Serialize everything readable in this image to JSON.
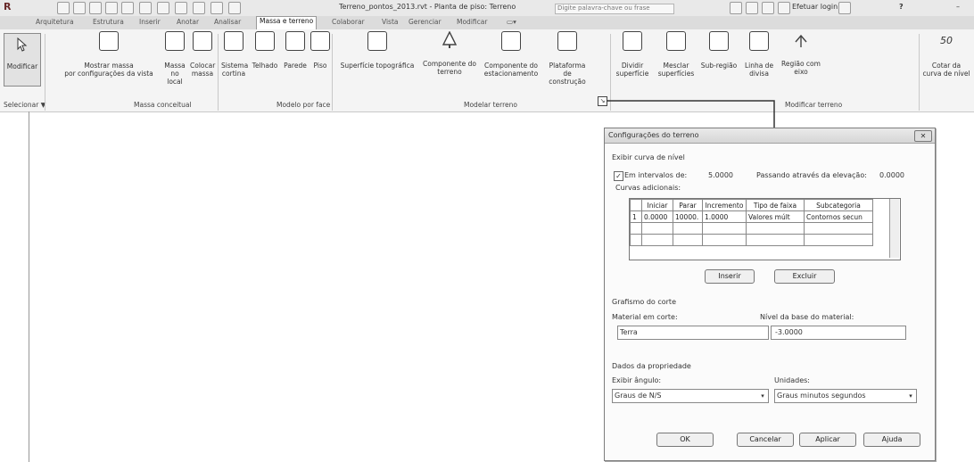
{
  "title_bar": {
    "app_menu": "R",
    "file_title": "Terreno_pontos_2013.rvt - Planta de piso: Terreno",
    "search_placeholder": "Digite palavra-chave ou frase",
    "signin_label": "Efetuar login",
    "help_label": "?"
  },
  "tabs": [
    "Arquitetura",
    "Estrutura",
    "Inserir",
    "Anotar",
    "Analisar",
    "Massa e terreno",
    "Colaborar",
    "Vista",
    "Gerenciar",
    "Modificar"
  ],
  "active_tab": "Massa e terreno",
  "ribbon": {
    "tools": {
      "modificar": "Modificar",
      "mostrar_massa": [
        "Mostrar massa",
        "por configurações da vista"
      ],
      "massa": [
        "Massa",
        "no local"
      ],
      "colocar_massa": [
        "Colocar",
        "massa"
      ],
      "sistema_cortina": [
        "Sistema",
        "cortina"
      ],
      "telhado": "Telhado",
      "parede": "Parede",
      "piso": "Piso",
      "superficie": "Superfície topográfica",
      "componente_terreno": [
        "Componente do",
        "terreno"
      ],
      "componente_estac": [
        "Componente do",
        "estacionamento"
      ],
      "plataforma": [
        "Plataforma de",
        "construção"
      ],
      "dividir": [
        "Dividir",
        "superfície"
      ],
      "mesclar": [
        "Mesclar",
        "superfícies"
      ],
      "subregiao": "Sub-região",
      "linha_divisa": [
        "Linha de",
        "divisa"
      ],
      "regiao_eixo": [
        "Região com",
        "eixo"
      ],
      "cotar": [
        "Cotar da",
        "curva de nível"
      ],
      "cotar_value": "50"
    },
    "groups": {
      "selecionar": "Selecionar ▼",
      "massa_conceitual": "Massa conceitual",
      "modelo_face": "Modelo por face",
      "modelar_terreno": "Modelar terreno",
      "modificar_terreno": "Modificar terreno"
    }
  },
  "dialog": {
    "title": "Configurações do terreno",
    "contour_section": "Exibir curva de nível",
    "em_intervalos": "Em intervalos de:",
    "intervalo_value": "5.0000",
    "passando_label": "Passando através da elevação:",
    "passando_value": "0.0000",
    "curvas_adicionais": "Curvas adicionais:",
    "table": {
      "headers": [
        "Iniciar",
        "Parar",
        "Incremento",
        "Tipo de faixa",
        "Subcategoria"
      ],
      "rows": [
        {
          "num": "1",
          "iniciar": "0.0000",
          "parar": "10000.",
          "incremento": "1.0000",
          "tipo": "Valores múlt",
          "sub": "Contornos secun"
        }
      ]
    },
    "inserir_label": "Inserir",
    "excluir_label": "Excluir",
    "grafismo_section": "Grafismo do corte",
    "material_label": "Material em corte:",
    "material_value": "Terra",
    "nivel_label": "Nível da base do material:",
    "nivel_value": "-3.0000",
    "dados_section": "Dados da propriedade",
    "exibir_angulo_label": "Exibir ângulo:",
    "exibir_angulo_value": "Graus de N/S",
    "unidades_label": "Unidades:",
    "unidades_value": "Graus minutos segundos",
    "ok_label": "OK",
    "cancelar_label": "Cancelar",
    "aplicar_label": "Aplicar",
    "ajuda_label": "Ajuda"
  }
}
